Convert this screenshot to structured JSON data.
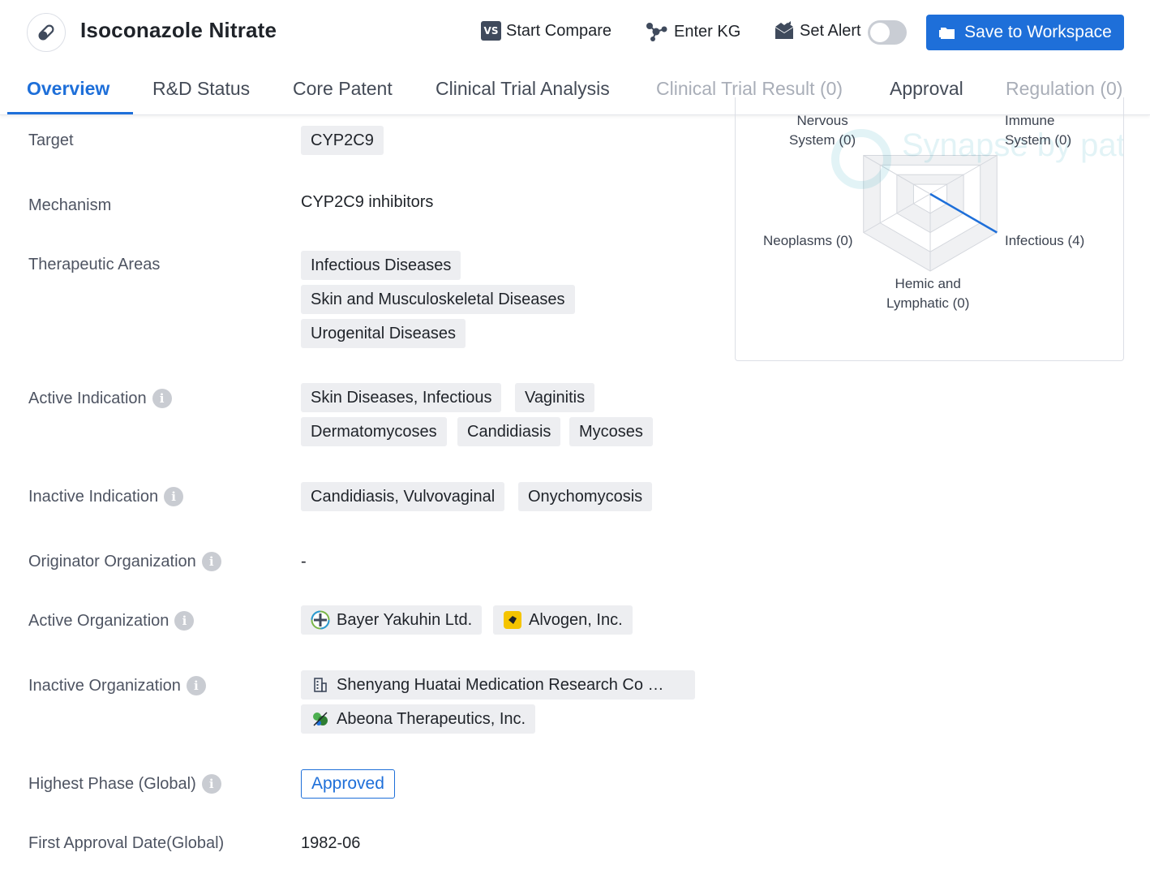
{
  "header": {
    "title": "Isoconazole Nitrate",
    "vs_badge": "VS",
    "start_compare": "Start Compare",
    "enter_kg": "Enter KG",
    "set_alert": "Set Alert",
    "save_to_workspace": "Save to Workspace",
    "accent_color": "#1e6fd9"
  },
  "tabs": [
    {
      "label": "Overview",
      "state": "active"
    },
    {
      "label": "R&D Status",
      "state": "normal"
    },
    {
      "label": "Core Patent",
      "state": "normal"
    },
    {
      "label": "Clinical Trial Analysis",
      "state": "normal"
    },
    {
      "label": "Clinical Trial Result (0)",
      "state": "disabled"
    },
    {
      "label": "Approval",
      "state": "normal"
    },
    {
      "label": "Regulation (0)",
      "state": "disabled"
    }
  ],
  "overview": {
    "target": {
      "label": "Target",
      "tags": [
        "CYP2C9"
      ]
    },
    "mechanism": {
      "label": "Mechanism",
      "value": "CYP2C9 inhibitors"
    },
    "therapeutic_areas": {
      "label": "Therapeutic Areas",
      "tags": [
        "Infectious Diseases",
        "Skin and Musculoskeletal Diseases",
        "Urogenital Diseases"
      ]
    },
    "active_indication": {
      "label": "Active Indication",
      "tags": [
        "Skin Diseases, Infectious",
        "Vaginitis",
        "Dermatomycoses",
        "Candidiasis",
        "Mycoses"
      ]
    },
    "inactive_indication": {
      "label": "Inactive Indication",
      "tags": [
        "Candidiasis, Vulvovaginal",
        "Onychomycosis"
      ]
    },
    "originator_organization": {
      "label": "Originator Organization",
      "value": "-"
    },
    "active_organization": {
      "label": "Active Organization",
      "orgs": [
        {
          "name": "Bayer Yakuhin Ltd.",
          "logo": "bayer-logo-icon"
        },
        {
          "name": "Alvogen, Inc.",
          "logo": "alvogen-logo-icon"
        }
      ]
    },
    "inactive_organization": {
      "label": "Inactive Organization",
      "orgs": [
        {
          "name": "Shenyang Huatai Medication Research Co …",
          "logo": "building-icon"
        },
        {
          "name": "Abeona Therapeutics, Inc.",
          "logo": "abeona-logo-icon"
        }
      ]
    },
    "highest_phase": {
      "label": "Highest Phase (Global)",
      "value": "Approved"
    },
    "first_approval_date": {
      "label": "First Approval Date(Global)",
      "value": "1982-06"
    }
  },
  "radar": {
    "axes": [
      {
        "line1": "Nervous",
        "line2": "System (0)",
        "value": 0
      },
      {
        "line1": "Immune",
        "line2": "System (0)",
        "value": 0
      },
      {
        "line1": "Infectious (4)",
        "line2": "",
        "value": 4
      },
      {
        "line1": "Hemic and",
        "line2": "Lymphatic (0)",
        "value": 0
      },
      {
        "line1": "Neoplasms (0)",
        "line2": "",
        "value": 0
      }
    ],
    "max": 4,
    "series_color": "#1e6fd9",
    "watermark": "Synapse by patsnap"
  }
}
